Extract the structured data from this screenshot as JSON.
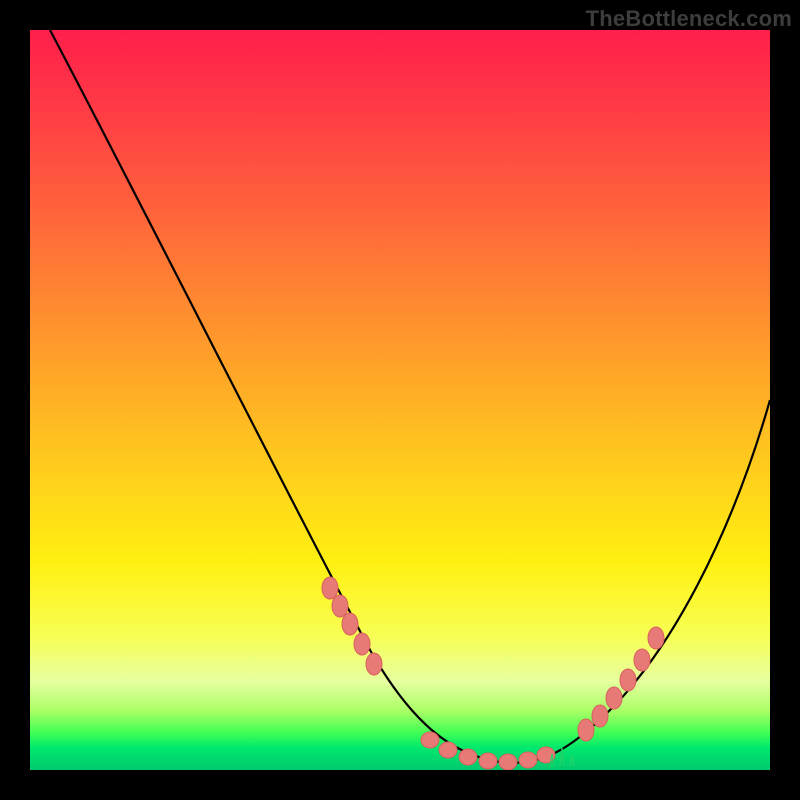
{
  "watermark": "TheBottleneck.com",
  "colors": {
    "background": "#000000",
    "gradient_top": "#ff1f4b",
    "gradient_mid": "#ffcf1c",
    "gradient_bottom": "#00c96e",
    "curve": "#000000",
    "marker_fill": "#e77a76",
    "marker_stroke": "#d8605c"
  },
  "chart_data": {
    "type": "line",
    "title": "",
    "xlabel": "",
    "ylabel": "",
    "xlim": [
      0,
      100
    ],
    "ylim": [
      0,
      100
    ],
    "grid": false,
    "series": [
      {
        "name": "bottleneck-curve",
        "x": [
          0,
          5,
          10,
          15,
          20,
          25,
          30,
          35,
          40,
          45,
          50,
          52,
          55,
          58,
          60,
          62,
          65,
          68,
          70,
          75,
          80,
          85,
          90,
          95,
          100
        ],
        "y": [
          100,
          93,
          86,
          79,
          72,
          64,
          56,
          48,
          39,
          30,
          20,
          16,
          10,
          6,
          4,
          3,
          2,
          3,
          5,
          10,
          18,
          27,
          36,
          44,
          50
        ],
        "comment": "y is bottleneck percentage; 0 = best (green bottom), 100 = worst (red top). Values visually estimated from the curve against the gradient."
      }
    ],
    "markers": {
      "comment": "Pink/salmon circular markers overlaid on the curve near the low-bottleneck region.",
      "x": [
        38,
        40,
        42,
        44,
        52,
        55,
        58,
        61,
        63,
        66,
        68,
        70,
        72,
        74,
        76,
        78,
        80
      ],
      "y": [
        45,
        40,
        35,
        30,
        16,
        10,
        6,
        3,
        2,
        2,
        3,
        5,
        7,
        9,
        12,
        15,
        18
      ]
    }
  }
}
